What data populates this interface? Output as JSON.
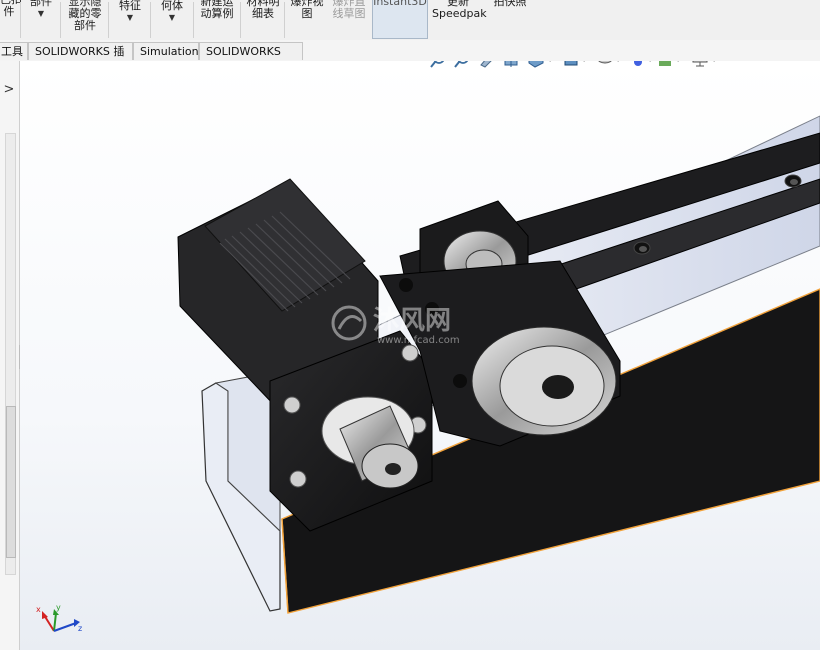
{
  "ribbon": {
    "buttons": [
      {
        "id": "cut-left",
        "lines": [
          "已扣",
          "件"
        ],
        "disabled": false
      },
      {
        "id": "parts",
        "lines": [
          "部件"
        ],
        "disabled": false,
        "caret": true
      },
      {
        "id": "show-hidden",
        "lines": [
          "显示隐",
          "藏的零",
          "部件"
        ],
        "disabled": false
      },
      {
        "id": "features",
        "lines": [
          "特征"
        ],
        "disabled": false,
        "caret": true
      },
      {
        "id": "geometry",
        "lines": [
          "何体"
        ],
        "disabled": false,
        "caret": true
      },
      {
        "id": "new-motion",
        "lines": [
          "新建运",
          "动算例"
        ],
        "disabled": false
      },
      {
        "id": "bom",
        "lines": [
          "材料明",
          "细表"
        ],
        "disabled": false
      },
      {
        "id": "exploded",
        "lines": [
          "爆炸视",
          "图"
        ],
        "disabled": false
      },
      {
        "id": "explode-sketch",
        "lines": [
          "爆炸直",
          "线草图"
        ],
        "disabled": true
      },
      {
        "id": "instant3d",
        "lines": [
          "Instant3D"
        ],
        "disabled": false,
        "active": true
      },
      {
        "id": "speedpak",
        "lines": [
          "更新",
          "Speedpak"
        ],
        "disabled": false
      },
      {
        "id": "snapshot",
        "lines": [
          "拍快照"
        ],
        "disabled": false
      }
    ]
  },
  "tabs": [
    {
      "label": "工具"
    },
    {
      "label": "SOLIDWORKS 插件"
    },
    {
      "label": "Simulation"
    },
    {
      "label": "SOLIDWORKS MBD"
    }
  ],
  "heads_up_icons": [
    "zoom-to-fit-icon",
    "zoom-to-area-icon",
    "previous-view-icon",
    "section-view-icon",
    "view-orientation-icon",
    "display-style-icon",
    "hide-show-items-icon",
    "edit-appearance-icon",
    "apply-scene-icon",
    "view-settings-icon"
  ],
  "left_panel": {
    "expand_arrow": ">"
  },
  "watermark": {
    "brand": "沐风网",
    "url": "www.mfcad.com"
  },
  "colors": {
    "viewport_top": "#ffffff",
    "viewport_bottom": "#e9edf3",
    "edge_highlight": "#f2a23a"
  }
}
